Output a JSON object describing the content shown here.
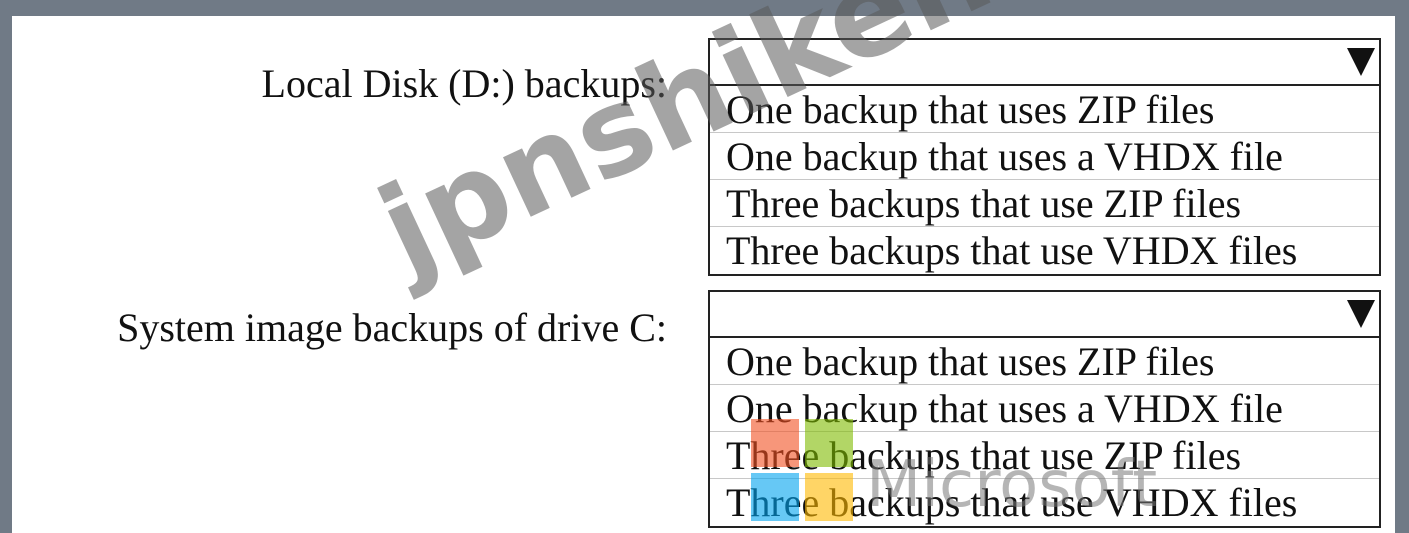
{
  "colors": {
    "frame": "#707a86",
    "panel": "#ffffff",
    "text": "#111111",
    "ms_red": "#f25022",
    "ms_green": "#7fba00",
    "ms_blue": "#00a4ef",
    "ms_yellow": "#ffb900"
  },
  "rows": [
    {
      "label": "Local Disk (D:) backups:",
      "selected": "",
      "options": [
        "One backup that uses ZIP files",
        "One backup that uses a VHDX file",
        "Three backups that use ZIP files",
        "Three backups that use VHDX files"
      ]
    },
    {
      "label": "System image backups of drive C:",
      "selected": "",
      "options": [
        "One backup that uses ZIP files",
        "One backup that uses a VHDX file",
        "Three backups that use ZIP files",
        "Three backups that use VHDX files"
      ]
    }
  ],
  "watermark": {
    "site": "jpnshiken.com",
    "brand": "Microsoft"
  },
  "icons": {
    "dropdown": "dropdown-arrow-icon",
    "logo": "microsoft-logo-icon"
  }
}
